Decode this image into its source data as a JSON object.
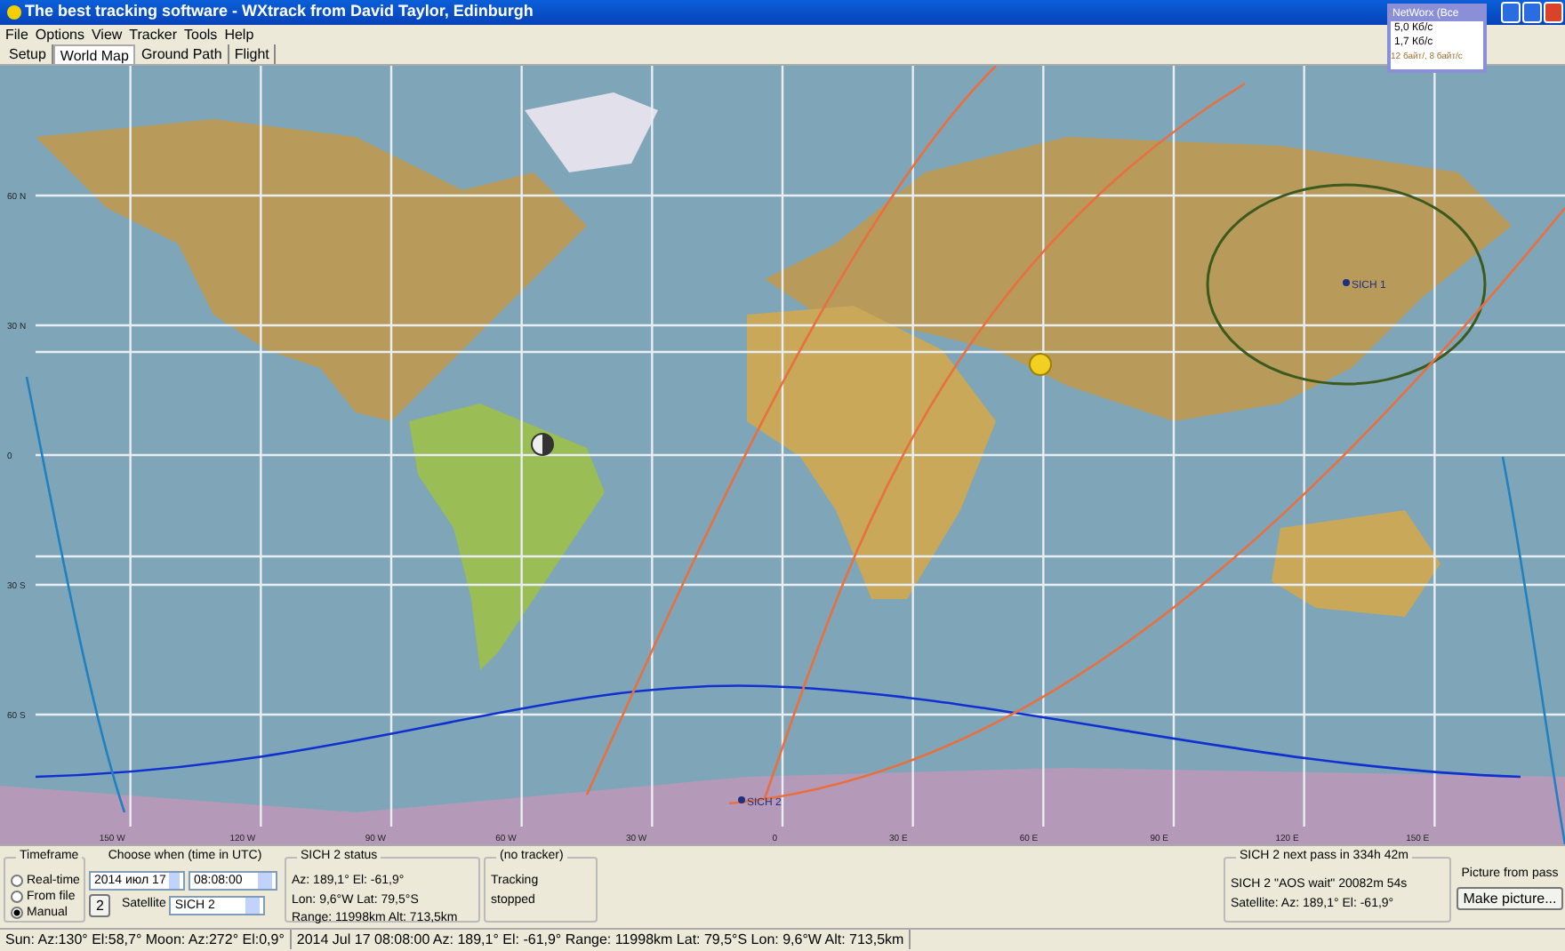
{
  "window": {
    "title": "The best tracking software - WXtrack from David Taylor, Edinburgh"
  },
  "menu": [
    "File",
    "Options",
    "View",
    "Tracker",
    "Tools",
    "Help"
  ],
  "tabs": [
    {
      "label": "Setup",
      "selected": false
    },
    {
      "label": "World Map",
      "selected": true
    },
    {
      "label": "Ground Path",
      "selected": false
    },
    {
      "label": "Flight",
      "selected": false
    }
  ],
  "networx": {
    "title": "NetWorx (Все",
    "download": "5,0 Кб/с",
    "upload": "1,7 Кб/с",
    "totals": "12 байт/, 8 байт/с"
  },
  "map": {
    "lat_labels": [
      "60 N",
      "30 N",
      "0",
      "30 S",
      "60 S"
    ],
    "lon_labels": [
      "150 W",
      "120 W",
      "90 W",
      "60 W",
      "30 W",
      "0",
      "30 E",
      "60 E",
      "90 E",
      "120 E",
      "150 E"
    ],
    "satellites": [
      {
        "label": "SICH 1"
      },
      {
        "label": "SICH 2"
      }
    ]
  },
  "timeframe": {
    "title": "Timeframe",
    "options": [
      {
        "label": "Real-time",
        "selected": false
      },
      {
        "label": "From file",
        "selected": false
      },
      {
        "label": "Manual",
        "selected": true
      }
    ]
  },
  "choose": {
    "title": "Choose when (time in UTC)",
    "date": "2014 июл 17",
    "time": "08:08:00",
    "step_button": "2",
    "satellite_label": "Satellite",
    "satellite": "SICH 2"
  },
  "status": {
    "title": "SICH 2 status",
    "lines": [
      "Az: 189,1°  El: -61,9°",
      "Lon: 9,6°W  Lat: 79,5°S",
      "Range: 11998km  Alt: 713,5km"
    ]
  },
  "tracker": {
    "title": "(no tracker)",
    "lines": [
      "Tracking",
      "stopped"
    ]
  },
  "next_pass": {
    "title": "SICH 2 next pass in 334h 42m",
    "lines": [
      "SICH 2  \"AOS wait\"  20082m 54s",
      "Satellite:  Az: 189,1°  El: -61,9°"
    ]
  },
  "picture": {
    "label": "Picture from pass",
    "button": "Make picture..."
  },
  "status_bar": [
    "Sun: Az:130° El:58,7°  Moon: Az:272° El:0,9°",
    "2014 Jul 17  08:08:00  Az: 189,1°  El: -61,9°  Range: 11998km  Lat: 79,5°S  Lon: 9,6°W  Alt: 713,5km"
  ]
}
